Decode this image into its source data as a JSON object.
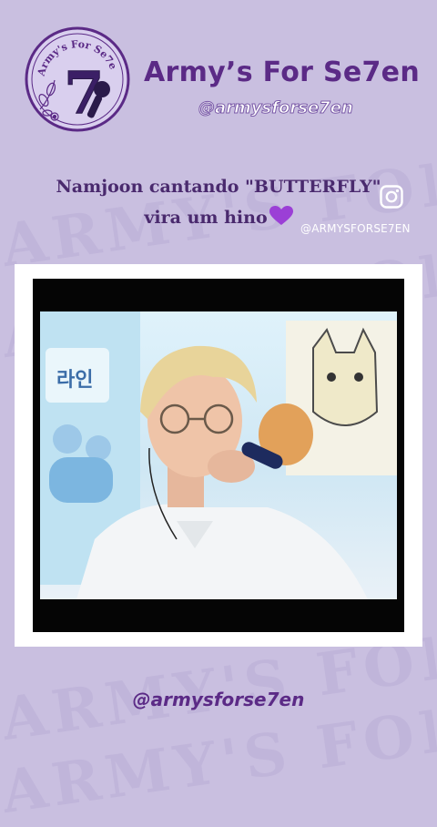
{
  "brand": {
    "logo_ring_text": "Army's For Se7en",
    "logo_numeral": "7",
    "title": "Army’s For Se7en",
    "handle": "@armysforse7en"
  },
  "headline": {
    "line1": "Namjoon cantando \"BUTTERFLY\"",
    "line2": "vira um hino"
  },
  "instagram": {
    "icon": "instagram-icon",
    "handle": "@ARMYSFORSE7EN"
  },
  "video": {
    "scene_sign_text": "라인"
  },
  "footer": {
    "handle": "@armysforse7en"
  },
  "watermark": {
    "text": "ARMY'S FOR SE7EN"
  },
  "colors": {
    "background": "#c9bfe0",
    "brand_purple": "#5b2a86",
    "heart": "#9b3fd6"
  }
}
